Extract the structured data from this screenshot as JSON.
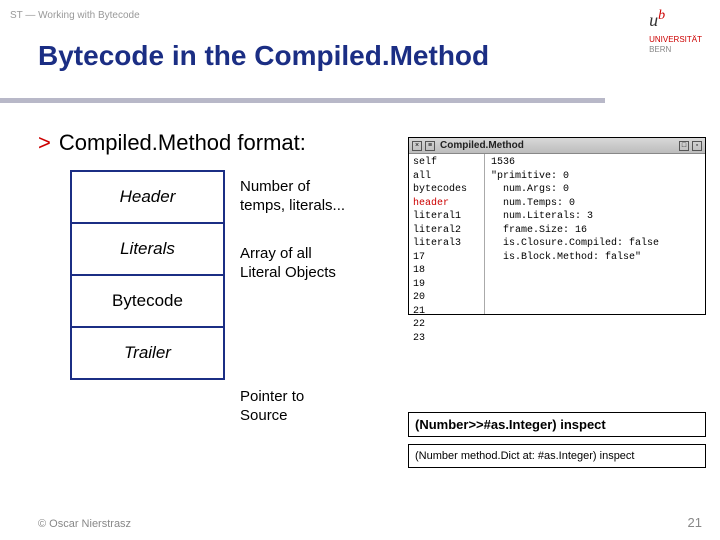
{
  "breadcrumb": "ST — Working with Bytecode",
  "university": {
    "part1": "UNIVERSITÄT",
    "part2": "BERN"
  },
  "title": "Bytecode in the Compiled.Method",
  "bullet": "Compiled.Method format:",
  "blocks": {
    "header": "Header",
    "literals": "Literals",
    "bytecode": "Bytecode",
    "trailer": "Trailer"
  },
  "descriptions": {
    "header": "Number of\ntemps, literals...",
    "literals": "Array of all\nLiteral Objects",
    "trailer": "Pointer to\nSource"
  },
  "inspector": {
    "title": "Compiled.Method",
    "left": {
      "items": [
        "self",
        "all bytecodes",
        "header",
        "literal1",
        "literal2",
        "literal3",
        "17",
        "18",
        "19",
        "20",
        "21",
        "22",
        "23"
      ],
      "selected": "header"
    },
    "right": {
      "top": "1536",
      "line2": "\"primitive: 0",
      "line3": "num.Args: 0",
      "line4": "num.Temps: 0",
      "line5": "num.Literals: 3",
      "line6": "frame.Size: 16",
      "line7": "is.Closure.Compiled: false",
      "line8": "is.Block.Method: false\""
    }
  },
  "code1": "(Number>>#as.Integer) inspect",
  "code2": "(Number method.Dict at: #as.Integer) inspect",
  "footer": {
    "left": "© Oscar Nierstrasz",
    "right": "21"
  }
}
